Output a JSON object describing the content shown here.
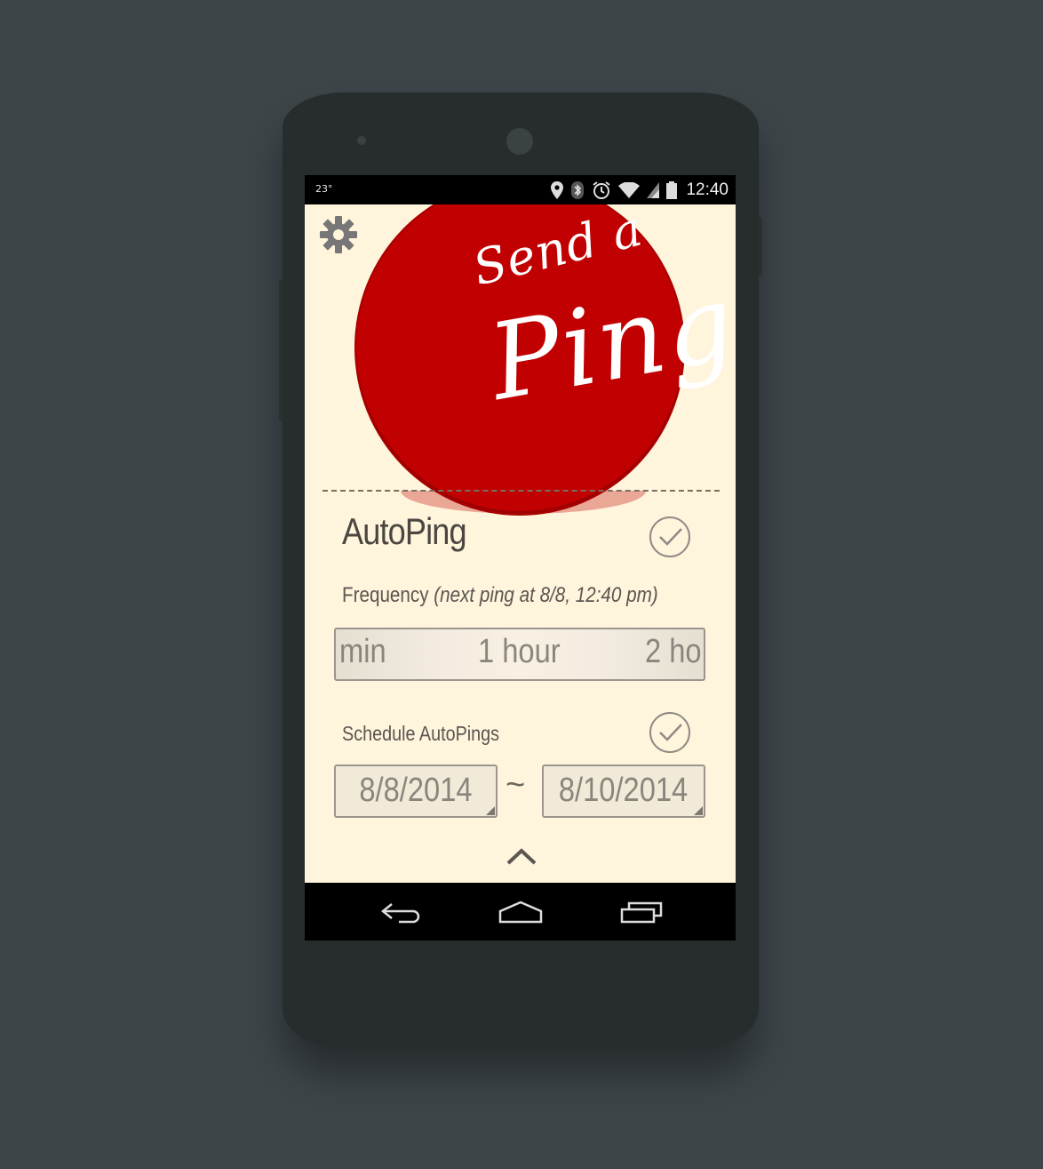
{
  "status_bar": {
    "temperature": "23°",
    "time": "12:40",
    "icons": [
      "location-icon",
      "bluetooth-icon",
      "alarm-icon",
      "wifi-icon",
      "signal-icon",
      "battery-icon"
    ]
  },
  "header": {
    "settings_icon": "gear-icon"
  },
  "ping_button": {
    "line1": "Send a",
    "line2": "Ping",
    "color": "#c10002"
  },
  "autoping": {
    "title": "AutoPing",
    "enabled": true,
    "frequency": {
      "label": "Frequency",
      "note": "(next ping at 8/8, 12:40 pm)",
      "options_visible": [
        "min",
        "1 hour",
        "2 ho"
      ],
      "selected": "1 hour"
    },
    "schedule": {
      "label": "Schedule AutoPings",
      "enabled": true,
      "start_date": "8/8/2014",
      "separator": "~",
      "end_date": "8/10/2014"
    }
  },
  "nav_bar": {
    "buttons": [
      "back-icon",
      "home-icon",
      "recents-icon"
    ]
  },
  "colors": {
    "background": "#3d4549",
    "content_bg": "#fff4dc",
    "accent_red": "#c10002"
  }
}
